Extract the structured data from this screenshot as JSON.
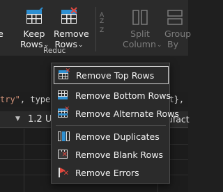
{
  "ribbon": {
    "keep_rows": {
      "line1": "Keep",
      "line2": "Rows"
    },
    "remove_rows": {
      "line1": "Remove",
      "line2": "Rows"
    },
    "split_column": {
      "line1": "Split",
      "line2": "Column"
    },
    "group_by": {
      "line1": "Group",
      "line2": "By"
    },
    "left_partial": {
      "line1": "",
      "line2": "e"
    },
    "group_label": "Reduc"
  },
  "formula": {
    "left_str": "try\"",
    "left_rest": ", type ",
    "right_rest": "ext},"
  },
  "grid": {
    "col_type": "1.2",
    "col_name": "U",
    "col3": "nufact"
  },
  "menu": {
    "items": [
      {
        "label": "Remove Top Rows",
        "icon": "remove-top-rows-icon"
      },
      {
        "label": "Remove Bottom Rows",
        "icon": "remove-bottom-rows-icon"
      },
      {
        "label": "Remove Alternate Rows",
        "icon": "remove-alternate-rows-icon"
      },
      {
        "label": "Remove Duplicates",
        "icon": "remove-duplicates-icon"
      },
      {
        "label": "Remove Blank Rows",
        "icon": "remove-blank-rows-icon"
      },
      {
        "label": "Remove Errors",
        "icon": "remove-errors-icon"
      }
    ]
  },
  "colors": {
    "accent_blue": "#2e8fd1",
    "delete_red": "#e2473d",
    "menu_bg": "#2b2b2b",
    "ribbon_bg": "#2b2b2b"
  }
}
